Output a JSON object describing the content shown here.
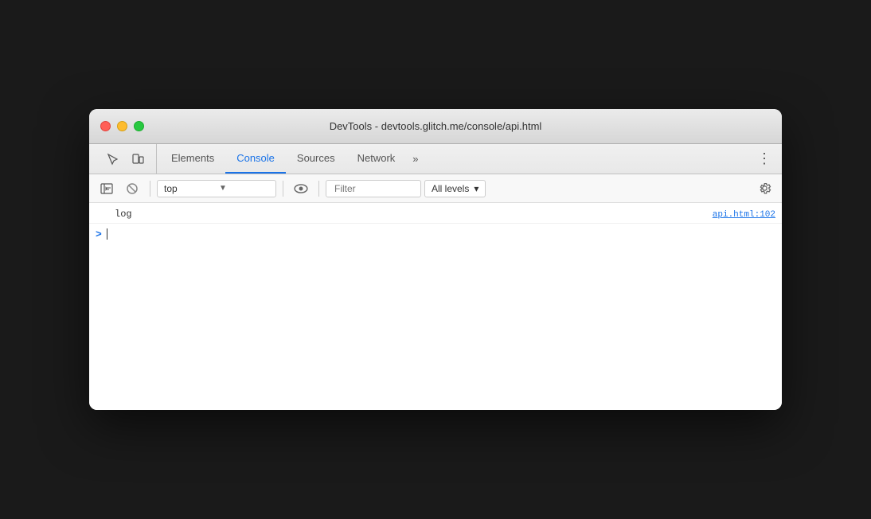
{
  "window": {
    "title": "DevTools - devtools.glitch.me/console/api.html"
  },
  "traffic_lights": {
    "close_color": "#ff5f57",
    "minimize_color": "#febc2e",
    "maximize_color": "#28c840"
  },
  "tabs": {
    "items": [
      {
        "label": "Elements",
        "active": false
      },
      {
        "label": "Console",
        "active": true
      },
      {
        "label": "Sources",
        "active": false
      },
      {
        "label": "Network",
        "active": false
      }
    ],
    "more_label": "»",
    "menu_label": "⋮"
  },
  "toolbar": {
    "context_value": "top",
    "context_arrow": "▼",
    "filter_placeholder": "Filter",
    "level_label": "All levels",
    "level_arrow": "▾"
  },
  "console": {
    "log_text": "log",
    "log_source": "api.html:102",
    "prompt_symbol": ">"
  }
}
